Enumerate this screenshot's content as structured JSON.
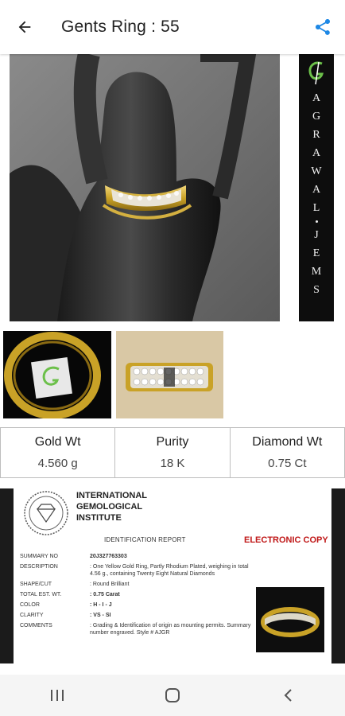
{
  "appbar": {
    "title": "Gents Ring : 55"
  },
  "logo": {
    "letters": [
      "A",
      "G",
      "R",
      "A",
      "W",
      "A",
      "L",
      "J",
      "E",
      "M",
      "S"
    ]
  },
  "specs": [
    {
      "label": "Gold Wt",
      "value": "4.560 g"
    },
    {
      "label": "Purity",
      "value": "18 K"
    },
    {
      "label": "Diamond Wt",
      "value": "0.75 Ct"
    }
  ],
  "certificate": {
    "institute": [
      "INTERNATIONAL",
      "GEMOLOGICAL",
      "INSTITUTE"
    ],
    "report_title": "IDENTIFICATION REPORT",
    "electronic_copy": "ELECTRONIC COPY",
    "rows": [
      {
        "key": "SUMMARY NO",
        "value": "20J327763303",
        "bold": true
      },
      {
        "key": "DESCRIPTION",
        "value": ": One Yellow Gold Ring, Partly Rhodium Plated, weighing in total 4.56 g., containing Twenty Eight Natural Diamonds",
        "bold": false
      },
      {
        "key": "SHAPE/CUT",
        "value": ": Round Brilliant",
        "bold": false
      },
      {
        "key": "TOTAL EST. WT.",
        "value": ": 0.75 Carat",
        "bold": true
      },
      {
        "key": "COLOR",
        "value": ": H - I - J",
        "bold": true
      },
      {
        "key": "CLARITY",
        "value": ": VS - SI",
        "bold": true
      },
      {
        "key": "COMMENTS",
        "value": ": Grading & Identification of origin as mounting permits. Summary number engraved. Style # AJGR",
        "bold": false
      }
    ]
  },
  "colors": {
    "accent": "#1e88e5",
    "ecopy": "#c01818",
    "gold": "#c9a227"
  },
  "icons": {
    "back": "arrow-back-icon",
    "share": "share-icon",
    "recents": "recents-icon",
    "home": "home-icon",
    "nav_back": "nav-back-icon"
  }
}
